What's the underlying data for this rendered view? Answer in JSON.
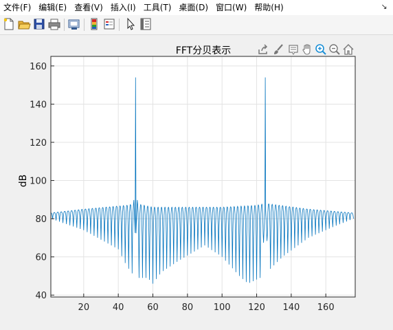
{
  "menubar": {
    "items": [
      "文件(F)",
      "编辑(E)",
      "查看(V)",
      "插入(I)",
      "工具(T)",
      "桌面(D)",
      "窗口(W)",
      "帮助(H)"
    ]
  },
  "toolbar": {
    "icons": [
      "new-figure-icon",
      "open-file-icon",
      "save-icon",
      "print-icon",
      "link-plot-icon",
      "insert-colorbar-icon",
      "insert-legend-icon",
      "edit-plot-arrow-icon",
      "property-inspector-icon"
    ]
  },
  "axes_toolbar": {
    "icons": [
      "export-icon",
      "brush-icon",
      "data-tips-icon",
      "pan-hand-icon",
      "zoom-in-icon",
      "zoom-out-icon",
      "home-icon"
    ]
  },
  "colors": {
    "line": "#0072bd",
    "grid": "#e3e3e3",
    "axes_bg": "#ffffff",
    "figure_bg": "#f0f0f0",
    "zoom_in_active": "#1a8fd6"
  },
  "chart_data": {
    "type": "line",
    "title": "FFT分贝表示",
    "xlabel": "",
    "ylabel": "dB",
    "xlim": [
      1,
      177
    ],
    "ylim": [
      39,
      165
    ],
    "xticks": [
      20,
      40,
      60,
      80,
      100,
      120,
      140,
      160
    ],
    "yticks": [
      40,
      60,
      80,
      100,
      120,
      140,
      160
    ],
    "grid": true,
    "legend": "none",
    "series": [
      {
        "description": "dense oscillating FFT magnitude; upper envelope ~83-87 dB, lower envelope dipping to ~45 dB",
        "upper_envelope": [
          [
            1,
            83
          ],
          [
            20,
            85
          ],
          [
            45,
            87
          ],
          [
            50,
            88
          ],
          [
            60,
            86
          ],
          [
            80,
            86
          ],
          [
            100,
            86
          ],
          [
            120,
            87
          ],
          [
            125,
            88
          ],
          [
            150,
            85
          ],
          [
            176,
            83
          ]
        ],
        "lower_envelope": [
          [
            1,
            80
          ],
          [
            20,
            74
          ],
          [
            40,
            64
          ],
          [
            45,
            55
          ],
          [
            50,
            49
          ],
          [
            57,
            49
          ],
          [
            60,
            46
          ],
          [
            65,
            52
          ],
          [
            75,
            58
          ],
          [
            90,
            66
          ],
          [
            100,
            60
          ],
          [
            110,
            50
          ],
          [
            115,
            46
          ],
          [
            122,
            49
          ],
          [
            126,
            52
          ],
          [
            135,
            60
          ],
          [
            150,
            70
          ],
          [
            165,
            76
          ],
          [
            176,
            80
          ]
        ],
        "peaks": [
          [
            50,
            154
          ],
          [
            125,
            154
          ]
        ],
        "period_x": 2
      }
    ]
  }
}
